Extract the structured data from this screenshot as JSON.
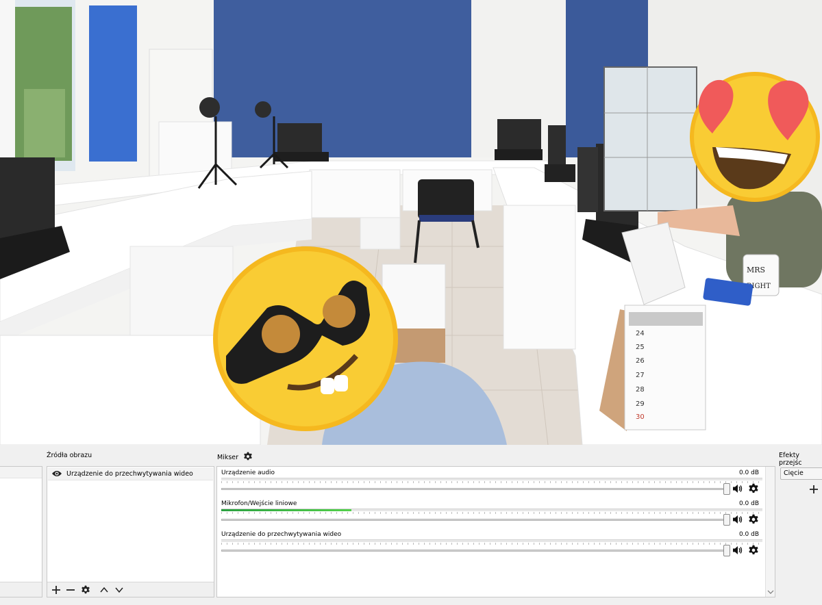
{
  "dock": {
    "sources_title": "Źródła obrazu",
    "mixer_title": "Mikser",
    "transitions_title": "Efekty przejśc"
  },
  "sources": {
    "items": [
      {
        "label": "Urządzenie do przechwytywania wideo",
        "icon": "eye-icon"
      }
    ],
    "toolbar": [
      "plus-icon",
      "minus-icon",
      "gear-icon",
      "chevron-up-icon",
      "chevron-down-icon"
    ]
  },
  "mixer": {
    "tracks": [
      {
        "name": "Urządzenie audio",
        "db": "0.0 dB",
        "level": 0.0
      },
      {
        "name": "Mikrofon/Wejście liniowe",
        "db": "0.0 dB",
        "level": 0.24
      },
      {
        "name": "Urządzenie do przechwytywania wideo",
        "db": "0.0 dB",
        "level": 0.0
      }
    ]
  },
  "transitions": {
    "selected": "Cięcie"
  },
  "colors": {
    "meter_green": "#2aa040",
    "wall_blue": "#3d5c9f"
  }
}
